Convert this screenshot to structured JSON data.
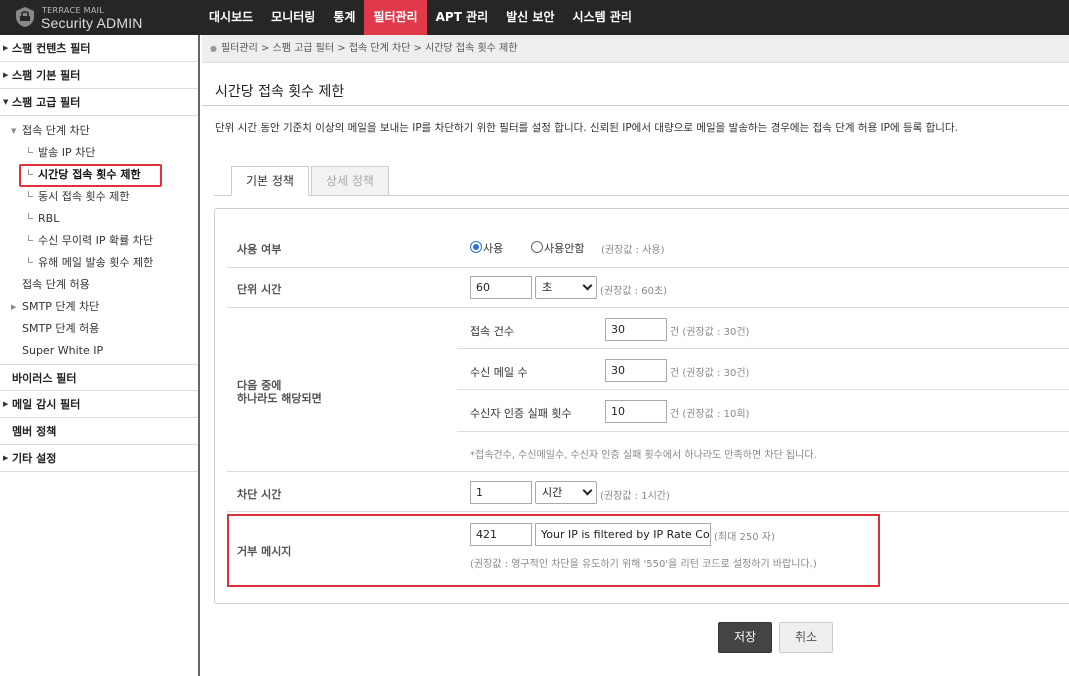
{
  "app": {
    "logo_small": "TERRACE MAIL",
    "logo_main": "Security ADMIN"
  },
  "topnav": [
    {
      "label": "대시보드",
      "active": false
    },
    {
      "label": "모니터링",
      "active": false
    },
    {
      "label": "통계",
      "active": false
    },
    {
      "label": "필터관리",
      "active": true
    },
    {
      "label": "APT 관리",
      "active": false
    },
    {
      "label": "발신 보안",
      "active": false
    },
    {
      "label": "시스템 관리",
      "active": false
    }
  ],
  "sidebar": {
    "group_spam_content": "스팸 컨텐츠 필터",
    "group_spam_basic": "스팸 기본 필터",
    "group_spam_advanced": "스팸 고급 필터",
    "sub_conn_block": "접속 단계 차단",
    "leaf_sender_ip": "발송 IP 차단",
    "leaf_hourly_conn": "시간당 접속 횟수 제한",
    "leaf_concurrent": "동시 접속 횟수 제한",
    "leaf_rbl": "RBL",
    "leaf_invalid_rcpt": "수신 무이력 IP 확률 차단",
    "leaf_harmful": "유해 메일 발송 횟수 제한",
    "plain_conn_allow": "접속 단계 허용",
    "sub_smtp_block": "SMTP 단계 차단",
    "plain_smtp_allow": "SMTP 단계 허용",
    "plain_super_white": "Super White IP",
    "group_virus": "바이러스 필터",
    "group_monitor": "메일 감시 필터",
    "group_member": "멤버 정책",
    "group_etc": "기타 설정"
  },
  "breadcrumb": "필터관리 > 스팸 고급 필터 > 접속 단계 차단 > 시간당 접속 횟수 제한",
  "page": {
    "title": "시간당 접속 횟수 제한",
    "description": "단위 시간 동안 기준치 이상의 메일을 보내는 IP를 차단하기 위한 필터를 설정 합니다. 신뢰된 IP에서 대량으로 메일을 발송하는 경우에는 접속 단계 허용 IP에 등록 합니다."
  },
  "tabs": [
    {
      "label": "기본 정책",
      "active": true
    },
    {
      "label": "상세 정책",
      "active": false
    }
  ],
  "form": {
    "use": {
      "label": "사용 여부",
      "option_on": "사용",
      "option_off": "사용안함",
      "selected": "사용",
      "hint": "(권장값 : 사용)"
    },
    "unit_time": {
      "label": "단위 시간",
      "value": "60",
      "unit": "초",
      "hint": "(권장값 : 60초)"
    },
    "condition": {
      "label_line1": "다음 중에",
      "label_line2": "하나라도 해당되면",
      "conn_count": {
        "label": "접속 건수",
        "value": "30",
        "suffix": "건 (권장값 : 30건)"
      },
      "mail_count": {
        "label": "수신 메일 수",
        "value": "30",
        "suffix": "건 (권장값 : 30건)"
      },
      "auth_fail": {
        "label": "수신자 인증 실패 횟수",
        "value": "10",
        "suffix": "건 (권장값 : 10회)"
      },
      "note": "*접속건수, 수신메일수, 수신자 인증 실패 횟수에서 하나라도 만족하면 차단 됩니다."
    },
    "block_time": {
      "label": "차단 시간",
      "value": "1",
      "unit": "시간",
      "hint": "(권장값 : 1시간)"
    },
    "reject_message": {
      "label": "거부 메시지",
      "code": "421",
      "message": "Your IP is filtered by IP Rate Control",
      "limit": "(최대 250 자)",
      "hint": "(권장값 : 영구적인 차단을 유도하기 위해 '550'을 리턴 코드로 설정하기 바랍니다.)"
    }
  },
  "buttons": {
    "save": "저장",
    "cancel": "취소"
  },
  "colors": {
    "topbar": "#262626",
    "active_nav": "#e03a4a",
    "highlight_border": "#d8333d",
    "radio_selected": "#2f6fd6"
  }
}
